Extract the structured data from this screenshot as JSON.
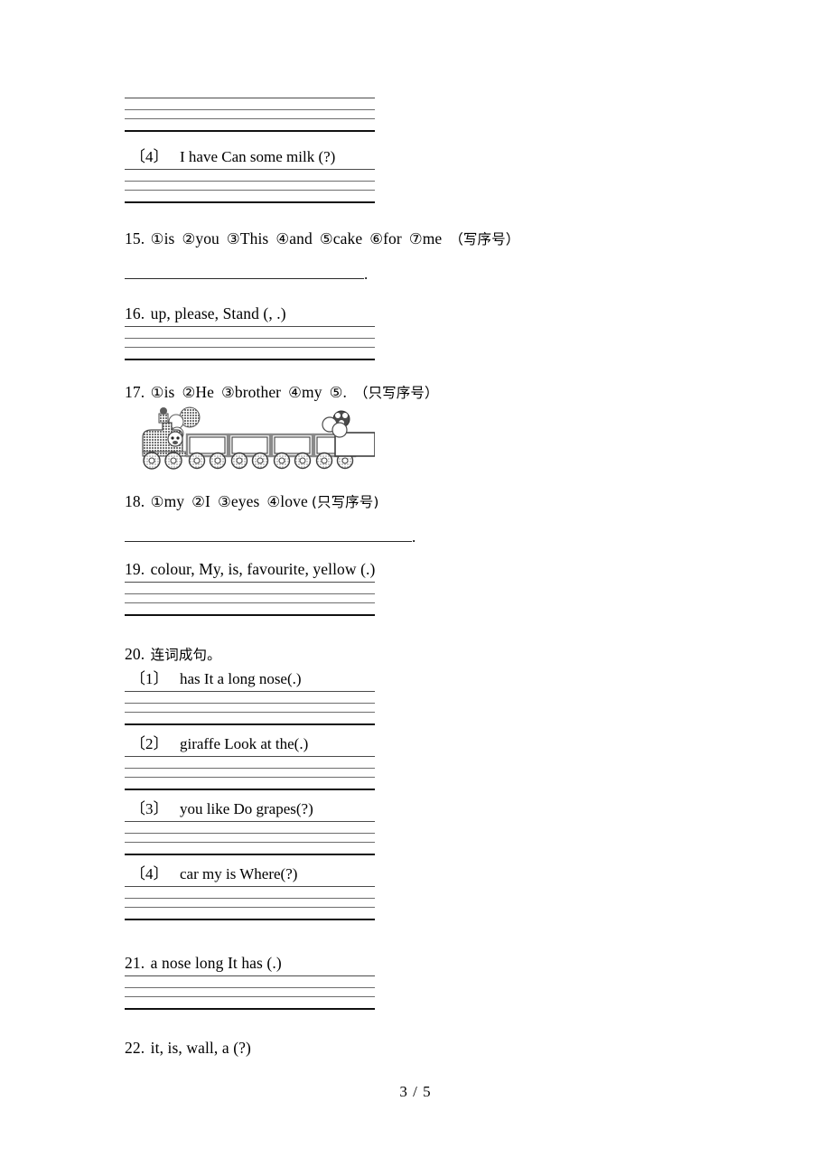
{
  "page": {
    "footer": "3 / 5"
  },
  "items": [
    {
      "id": "q14-4",
      "bracket_open": "〔",
      "bracket_num": "4",
      "bracket_close": "〕",
      "text": "I have   Can   some   milk (?)"
    },
    {
      "id": "q15",
      "number": "15.",
      "choices": [
        {
          "mark": "①",
          "word": "is"
        },
        {
          "mark": "②",
          "word": "you"
        },
        {
          "mark": "③",
          "word": "This"
        },
        {
          "mark": "④",
          "word": "and"
        },
        {
          "mark": "⑤",
          "word": "cake"
        },
        {
          "mark": "⑥",
          "word": "for"
        },
        {
          "mark": "⑦",
          "word": "me"
        }
      ],
      "hint": "（写序号）",
      "answer_terminator": "."
    },
    {
      "id": "q16",
      "number": "16.",
      "text": "up, please, Stand (, .)"
    },
    {
      "id": "q17",
      "number": "17.",
      "choices": [
        {
          "mark": "①",
          "word": "is"
        },
        {
          "mark": "②",
          "word": "He"
        },
        {
          "mark": "③",
          "word": "brother"
        },
        {
          "mark": "④",
          "word": "my"
        },
        {
          "mark": "⑤",
          "word": "."
        }
      ],
      "hint": "（只写序号）"
    },
    {
      "id": "q18",
      "number": "18.",
      "choices": [
        {
          "mark": "①",
          "word": "my"
        },
        {
          "mark": "②",
          "word": "I"
        },
        {
          "mark": "③",
          "word": "eyes"
        },
        {
          "mark": "④",
          "word": "love"
        }
      ],
      "hint": "(只写序号)",
      "answer_terminator": "."
    },
    {
      "id": "q19",
      "number": "19.",
      "text": "colour, My, is, favourite, yellow (.)"
    },
    {
      "id": "q20",
      "number": "20.",
      "text": "连词成句。",
      "subs": [
        {
          "bracket_open": "〔",
          "bracket_num": "1",
          "bracket_close": "〕",
          "text": "has It a long nose(.)"
        },
        {
          "bracket_open": "〔",
          "bracket_num": "2",
          "bracket_close": "〕",
          "text": "giraffe Look at the(.)"
        },
        {
          "bracket_open": "〔",
          "bracket_num": "3",
          "bracket_close": "〕",
          "text": "you like Do grapes(?)"
        },
        {
          "bracket_open": "〔",
          "bracket_num": "4",
          "bracket_close": "〕",
          "text": "car my is Where(?)"
        }
      ]
    },
    {
      "id": "q21",
      "number": "21.",
      "text": "a   nose   long   It   has   (.)"
    },
    {
      "id": "q22",
      "number": "22.",
      "text": "it, is, wall, a (?)"
    }
  ],
  "illustration": {
    "name": "train-clipart",
    "cars": 5,
    "description": "steam train with five empty boxcars"
  }
}
